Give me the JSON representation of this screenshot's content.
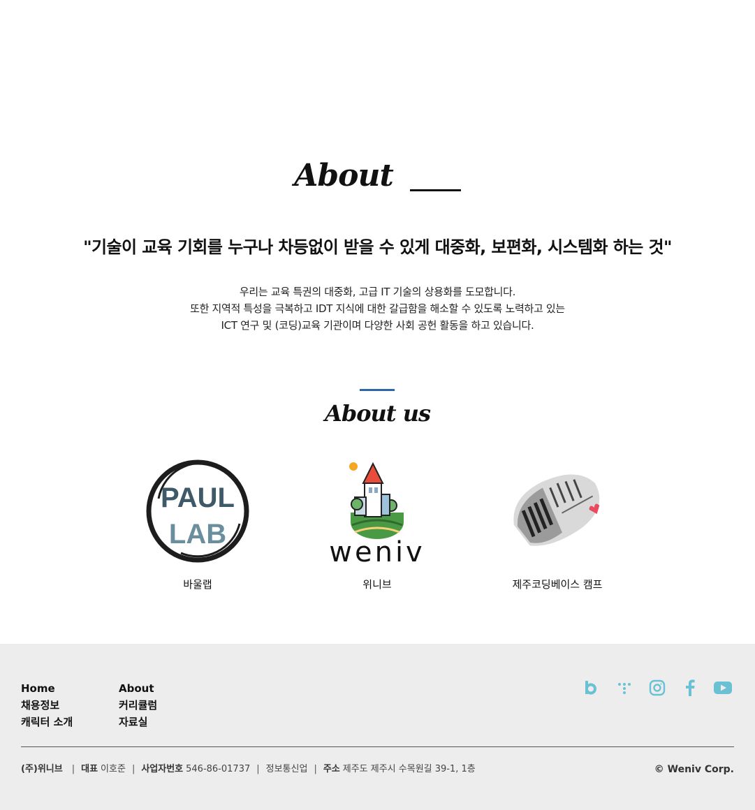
{
  "about": {
    "title": "About",
    "quote": "\"기술이 교육 기회를 누구나 차등없이 받을 수 있게 대중화, 보편화, 시스템화 하는 것\"",
    "description": [
      "우리는 교육 특권의 대중화, 고급 IT 기술의 상용화를 도모합니다.",
      "또한 지역적 특성을 극복하고 IDT 지식에 대한 갈급함을 해소할 수 있도록 노력하고 있는",
      "ICT 연구 및 (코딩)교육 기관이며 다양한 사회 공헌 활동을 하고 있습니다."
    ]
  },
  "about_us": {
    "title": "About us",
    "accent_color": "#2e67a8",
    "partners": [
      {
        "name": "바울랩",
        "logo_icon": "paullab-logo",
        "logo_text": [
          "PAUL",
          "LAB"
        ]
      },
      {
        "name": "위니브",
        "logo_icon": "weniv-logo",
        "logo_text": "weniv"
      },
      {
        "name": "제주코딩베이스 캠프",
        "logo_icon": "jeju-coding-base-camp-logo"
      }
    ]
  },
  "footer": {
    "nav_col1": [
      "Home",
      "채용정보",
      "캐릭터 소개"
    ],
    "nav_col2": [
      "About",
      "커리큘럼",
      "자료실"
    ],
    "socials": [
      {
        "name": "blog",
        "icon": "blog-b-icon"
      },
      {
        "name": "dots",
        "icon": "dots-icon"
      },
      {
        "name": "instagram",
        "icon": "instagram-icon"
      },
      {
        "name": "facebook",
        "icon": "facebook-icon"
      },
      {
        "name": "youtube",
        "icon": "youtube-icon"
      }
    ],
    "social_color": "#6ac1d3",
    "company": {
      "name": "(주)위니브",
      "ceo_label": "대표",
      "ceo": "이호준",
      "biz_label": "사업자번호",
      "biz_no": "546-86-01737",
      "category": "정보통신업",
      "addr_label": "주소",
      "address": "제주도 제주시 수목원길 39-1, 1층"
    },
    "copyright": "© Weniv Corp."
  }
}
